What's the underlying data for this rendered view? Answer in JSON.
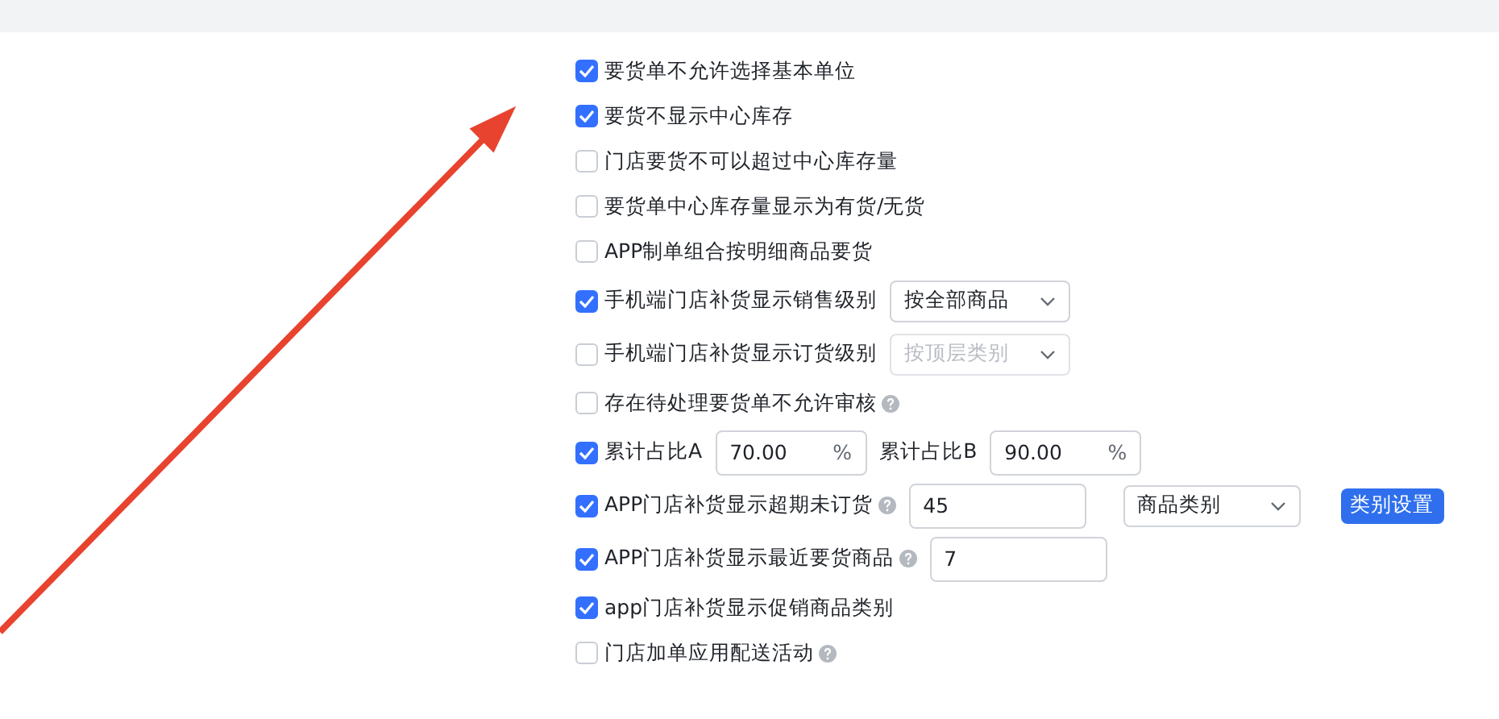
{
  "options": [
    {
      "kind": "plain",
      "label": "要货单不允许选择基本单位",
      "checked": true,
      "help": false
    },
    {
      "kind": "plain",
      "label": "要货不显示中心库存",
      "checked": true,
      "help": false
    },
    {
      "kind": "plain",
      "label": "门店要货不可以超过中心库存量",
      "checked": false,
      "help": false
    },
    {
      "kind": "plain",
      "label": "要货单中心库存量显示为有货/无货",
      "checked": false,
      "help": false
    },
    {
      "kind": "plain",
      "label": "APP制单组合按明细商品要货",
      "checked": false,
      "help": false
    },
    {
      "kind": "select",
      "label": "手机端门店补货显示销售级别",
      "checked": true,
      "help": false,
      "select": {
        "value": "按全部商品",
        "disabled": false
      }
    },
    {
      "kind": "select",
      "label": "手机端门店补货显示订货级别",
      "checked": false,
      "help": false,
      "select": {
        "value": "按顶层类别",
        "disabled": true
      }
    },
    {
      "kind": "plain",
      "label": "存在待处理要货单不允许审核",
      "checked": false,
      "help": true
    },
    {
      "kind": "ratio",
      "label": "累计占比A",
      "checked": true,
      "help": false,
      "input": {
        "value": "70.00",
        "unit": "%"
      },
      "second_label": "累计占比B",
      "second_input": {
        "value": "90.00",
        "unit": "%"
      }
    },
    {
      "kind": "overdue",
      "label": "APP门店补货显示超期未订货",
      "checked": true,
      "help": true,
      "input": {
        "value": "45"
      },
      "select": {
        "value": "商品类别",
        "disabled": false
      },
      "button": "类别设置"
    },
    {
      "kind": "input",
      "label": "APP门店补货显示最近要货商品",
      "checked": true,
      "help": true,
      "input": {
        "value": "7"
      }
    },
    {
      "kind": "plain",
      "label": "app门店补货显示促销商品类别",
      "checked": true,
      "help": false
    },
    {
      "kind": "plain",
      "label": "门店加单应用配送活动",
      "checked": false,
      "help": true
    }
  ]
}
